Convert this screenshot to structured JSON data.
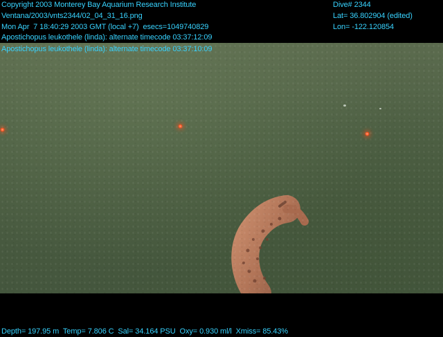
{
  "header": {
    "copyright": "Copyright 2003 Monterey Bay Aquarium Research Institute",
    "file_path": "Ventana/2003/vnts2344/02_04_31_16.png",
    "datetime": "Mon Apr  7 18:40:29 2003 GMT (local +7)  esecs=1049740829",
    "annotation_1": "Apostichopus leukothele (linda): alternate timecode 03:37:12:09",
    "annotation_2": "Apostichopus leukothele (linda): alternate timecode 03:37:10:09",
    "dive": "Dive# 2344",
    "lat": "Lat= 36.802904 (edited)",
    "lon": "Lon= -122.120854"
  },
  "footer": {
    "telemetry": "Depth= 197.95 m  Temp= 7.806 C  Sal= 34.164 PSU  Oxy= 0.930 ml/l  Xmiss= 85.43%"
  },
  "scene": {
    "subject": "sea-cucumber",
    "water_color": "#4f6145",
    "laser_color": "#ff4d1a",
    "text_color": "#38d3ff"
  }
}
